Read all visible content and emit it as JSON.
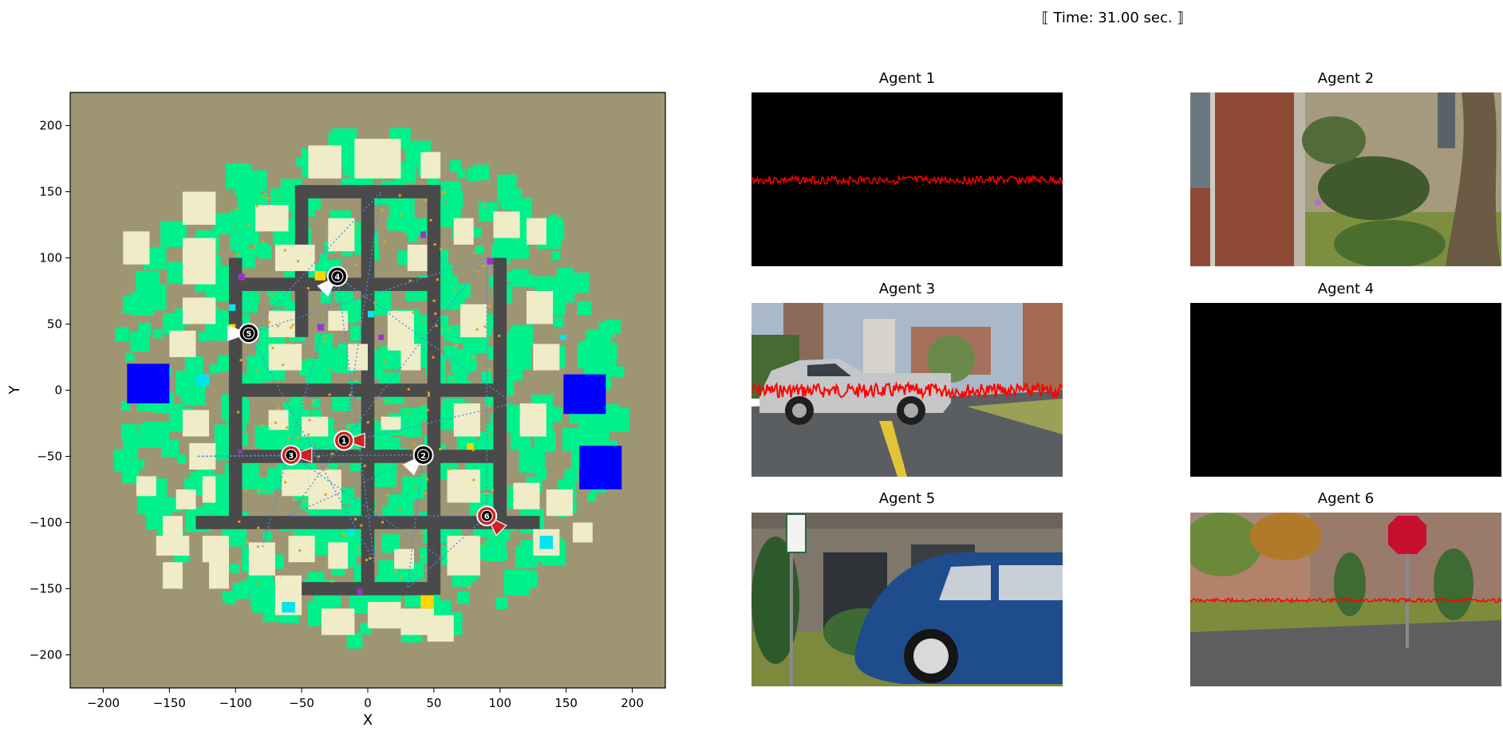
{
  "figure": {
    "time_label": "⟦ Time: 31.00 sec. ⟧"
  },
  "map": {
    "xlabel": "X",
    "ylabel": "Y",
    "xlim": [
      -225,
      225
    ],
    "ylim": [
      -225,
      225
    ],
    "xticks": [
      -200,
      -150,
      -100,
      -50,
      0,
      50,
      100,
      150,
      200
    ],
    "yticks": [
      -200,
      -150,
      -100,
      -50,
      0,
      50,
      100,
      150,
      200
    ],
    "colors": {
      "ground": "#9e9673",
      "vegetation": "#00f08c",
      "building": "#f0ecc8",
      "road": "#4a4a4a",
      "large_object": "#0000ff",
      "small_object_cyan": "#00e5ee",
      "small_object_yellow": "#ffd400",
      "small_object_purple": "#9932cc",
      "agent_red": "#cc2222",
      "agent_black": "#000000",
      "fov_line": "#4d8fdc"
    },
    "agents": [
      {
        "id": "1",
        "x": -18,
        "y": -38,
        "color": "red",
        "heading": "right"
      },
      {
        "id": "2",
        "x": 42,
        "y": -49,
        "color": "black",
        "heading": "down-left"
      },
      {
        "id": "3",
        "x": -58,
        "y": -49,
        "color": "red",
        "heading": "right"
      },
      {
        "id": "4",
        "x": -23,
        "y": 86,
        "color": "black",
        "heading": "down-left"
      },
      {
        "id": "5",
        "x": -90,
        "y": 43,
        "color": "black",
        "heading": "left"
      },
      {
        "id": "6",
        "x": 90,
        "y": -95,
        "color": "red",
        "heading": "down-right"
      }
    ]
  },
  "panels": [
    {
      "title": "Agent 1",
      "view": "black-noise"
    },
    {
      "title": "Agent 2",
      "view": "brick-building-garden"
    },
    {
      "title": "Agent 3",
      "view": "pickup-truck-street"
    },
    {
      "title": "Agent 4",
      "view": "black"
    },
    {
      "title": "Agent 5",
      "view": "blue-beetle-sign"
    },
    {
      "title": "Agent 6",
      "view": "stop-sign-intersection"
    }
  ]
}
